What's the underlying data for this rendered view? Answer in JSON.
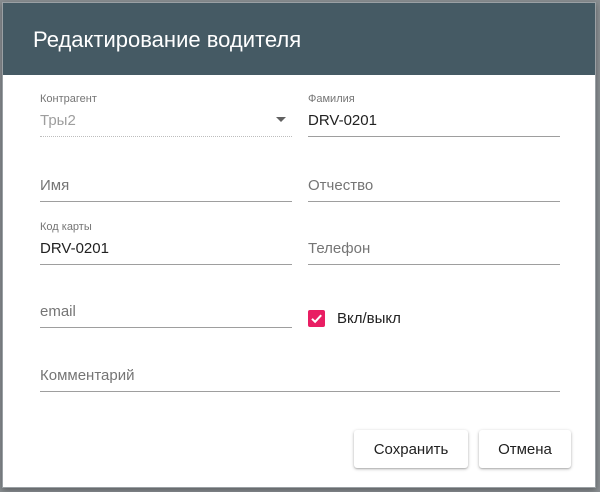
{
  "dialog": {
    "title": "Редактирование водителя",
    "colors": {
      "header": "#455a64",
      "accent": "#e91e63"
    }
  },
  "form": {
    "contractor": {
      "label": "Контрагент",
      "value": "Тры2"
    },
    "surname": {
      "label": "Фамилия",
      "value": "DRV-0201"
    },
    "name": {
      "placeholder": "Имя"
    },
    "patronymic": {
      "placeholder": "Отчество"
    },
    "card_code": {
      "label": "Код карты",
      "value": "DRV-0201"
    },
    "phone": {
      "placeholder": "Телефон"
    },
    "email": {
      "placeholder": "email"
    },
    "enabled": {
      "label": "Вкл/выкл",
      "checked": true
    },
    "comment": {
      "placeholder": "Комментарий"
    }
  },
  "actions": {
    "save_label": "Сохранить",
    "cancel_label": "Отмена"
  }
}
